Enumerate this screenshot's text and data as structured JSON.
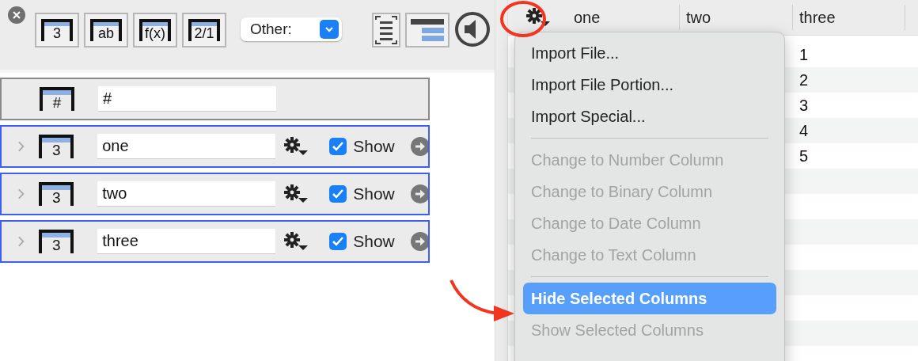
{
  "toolbar": {
    "type_buttons": [
      {
        "label": "3"
      },
      {
        "label": "ab"
      },
      {
        "label": "f(x)"
      },
      {
        "label": "2/1"
      }
    ],
    "other_select": {
      "label": "Other:"
    }
  },
  "column_list": [
    {
      "kind": "index",
      "type_label": "#",
      "name": "#",
      "selected": false
    },
    {
      "kind": "column",
      "type_label": "3",
      "name": "one",
      "selected": true,
      "show": true,
      "show_label": "Show"
    },
    {
      "kind": "column",
      "type_label": "3",
      "name": "two",
      "selected": true,
      "show": true,
      "show_label": "Show"
    },
    {
      "kind": "column",
      "type_label": "3",
      "name": "three",
      "selected": true,
      "show": true,
      "show_label": "Show"
    }
  ],
  "table": {
    "columns": [
      "one",
      "two",
      "three"
    ],
    "rows": [
      {
        "three": "1"
      },
      {
        "three": "2"
      },
      {
        "three": "3"
      },
      {
        "three": "4"
      },
      {
        "three": "5"
      },
      {},
      {},
      {},
      {},
      {},
      {},
      {}
    ]
  },
  "menu": {
    "items": [
      {
        "kind": "item",
        "label": "Import File...",
        "disabled": false,
        "selected": false
      },
      {
        "kind": "item",
        "label": "Import File Portion...",
        "disabled": false,
        "selected": false
      },
      {
        "kind": "item",
        "label": "Import Special...",
        "disabled": false,
        "selected": false
      },
      {
        "kind": "separator"
      },
      {
        "kind": "item",
        "label": "Change to Number Column",
        "disabled": true,
        "selected": false
      },
      {
        "kind": "item",
        "label": "Change to Binary Column",
        "disabled": true,
        "selected": false
      },
      {
        "kind": "item",
        "label": "Change to Date Column",
        "disabled": true,
        "selected": false
      },
      {
        "kind": "item",
        "label": "Change to Text Column",
        "disabled": true,
        "selected": false
      },
      {
        "kind": "separator"
      },
      {
        "kind": "item",
        "label": "Hide Selected Columns",
        "disabled": false,
        "selected": true
      },
      {
        "kind": "item",
        "label": "Show Selected Columns",
        "disabled": true,
        "selected": false
      }
    ]
  }
}
